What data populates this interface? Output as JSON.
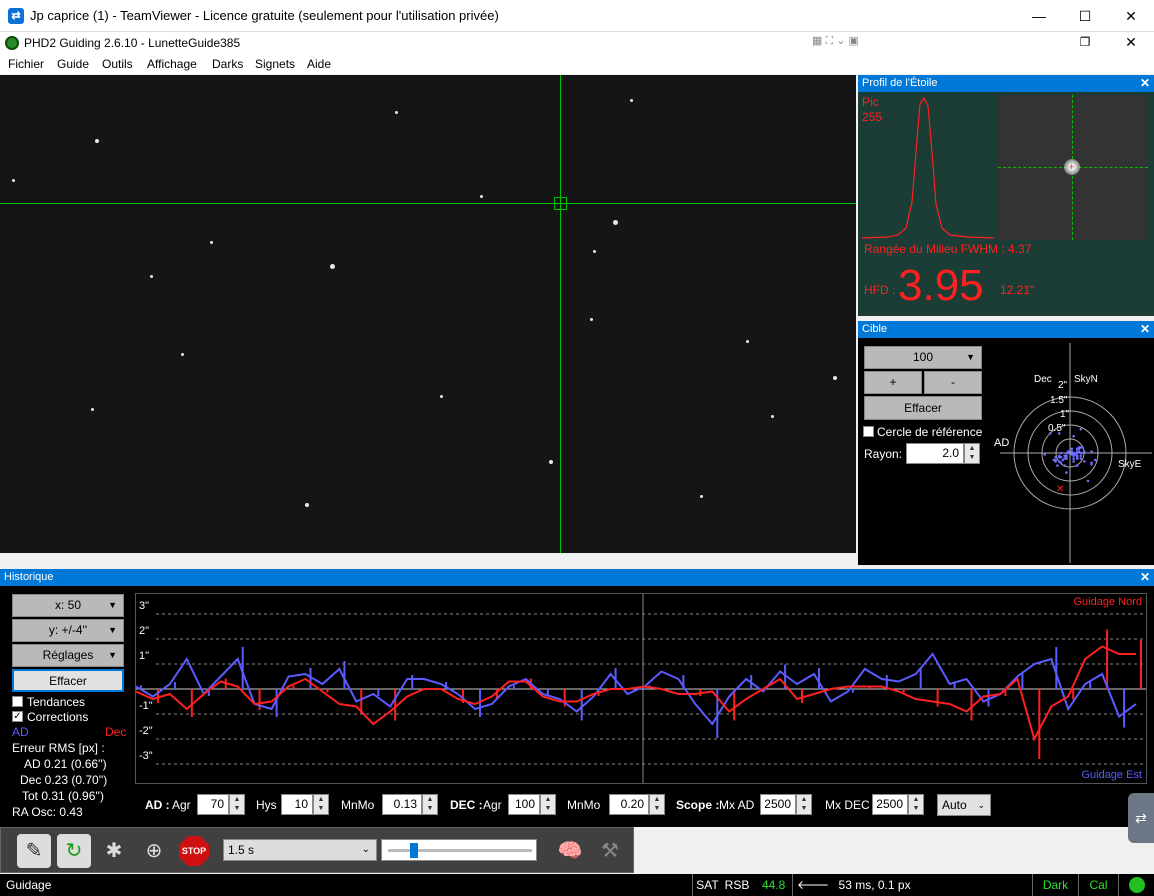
{
  "teamviewer": {
    "title": "Jp caprice (1) - TeamViewer - Licence gratuite (seulement pour l'utilisation privée)",
    "logo_icon": "teamviewer-icon"
  },
  "app": {
    "title": "PHD2 Guiding 2.6.10 - LunetteGuide385"
  },
  "menu": [
    "Fichier",
    "Guide",
    "Outils",
    "Affichage",
    "Darks",
    "Signets",
    "Aide"
  ],
  "star_profile": {
    "title": "Profil de l'Étoile",
    "pic_label": "Pic",
    "pic_value": "255",
    "fwhm_text": "Rangée du Milieu FWHM : 4.37",
    "hfd_label": "HFD :",
    "hfd_value": "3.95",
    "hfd_arcsec": "12.21\""
  },
  "target": {
    "title": "Cible",
    "scale_value": "100",
    "plus": "+",
    "minus": "-",
    "clear": "Effacer",
    "ref_circle": "Cercle de référence",
    "radius_label": "Rayon:",
    "radius_value": "2.0",
    "labels": {
      "dec": "Dec",
      "skyn": "SkyN",
      "ad": "AD",
      "skye": "SkyE",
      "r2": "2\"",
      "r15": "1.5\"",
      "r1": "1\"",
      "r05": "0.5\""
    }
  },
  "history": {
    "title": "Historique",
    "x_select": "x:  50",
    "y_select": "y: +/-4''",
    "settings": "Réglages",
    "clear": "Effacer",
    "trends": "Tendances",
    "corrections": "Corrections",
    "ad_label": "AD",
    "dec_label": "Dec",
    "rms_title": "Erreur RMS [px] :",
    "rms_ad": "AD  0.21 (0.66'')",
    "rms_dec": "Dec  0.23 (0.70'')",
    "rms_tot": "Tot  0.31 (0.96'')",
    "ra_osc": "RA Osc: 0.43",
    "legend_north": "Guidage Nord",
    "legend_east": "Guidage Est",
    "y_ticks": [
      "3\"",
      "2\"",
      "1\"",
      "-1\"",
      "-2\"",
      "-3\""
    ]
  },
  "controls": {
    "ad_label": "AD :",
    "agr_label": "Agr",
    "ad_agr": "70",
    "hys_label": "Hys",
    "hys": "10",
    "mnmo_label": "MnMo",
    "ad_mnmo": "0.13",
    "dec_label": "DEC :",
    "dec_agr": "100",
    "dec_mnmo": "0.20",
    "scope_label": "Scope :",
    "mxad_label": "Mx AD",
    "mxad": "2500",
    "mxdec_label": "Mx DEC",
    "mxdec": "2500",
    "auto": "Auto"
  },
  "toolbar": {
    "exposure": "1.5 s"
  },
  "status": {
    "left": "Guidage",
    "sat": "SAT",
    "rsb": "RSB",
    "rsb_value": "44.8",
    "timing": "53 ms, 0.1 px",
    "dark": "Dark",
    "cal": "Cal"
  },
  "colors": {
    "ra_line": "#5b5bff",
    "dec_line": "#ff2020",
    "crosshair": "#00c000",
    "accent": "#0078d7"
  },
  "chart_data": {
    "type": "line",
    "ylabel": "",
    "ylim": [
      -4,
      4
    ],
    "series": [
      {
        "name": "AD",
        "values": [
          0.1,
          -0.3,
          0.2,
          1.2,
          -0.2,
          0.5,
          1.2,
          -0.6,
          -0.8,
          0.5,
          0.6,
          0.2,
          0.8,
          -0.5,
          -0.2,
          -0.7,
          0.4,
          0.4,
          0.2,
          -0.2,
          -0.8,
          -0.6,
          0.1,
          0.4,
          -0.2,
          -0.4,
          -0.9,
          -0.3,
          0.6,
          -0.2,
          0.1,
          0.7,
          0.4,
          -0.6,
          -1.4,
          -0.3,
          0.4,
          -0.1,
          0.7,
          0.2,
          0.6,
          -0.5,
          -0.1,
          0.8,
          0.4,
          0.3,
          0.6,
          1.4,
          0.2,
          0.4,
          -0.5,
          -0.2,
          0.5,
          1.0,
          1.2,
          -0.8,
          0.2,
          0.6,
          -1.1,
          -0.6
        ]
      },
      {
        "name": "Dec",
        "values": [
          -0.1,
          -0.4,
          -0.2,
          -0.8,
          -0.2,
          0.3,
          0.1,
          -0.6,
          -0.5,
          0.1,
          0.4,
          -0.1,
          -0.6,
          -0.7,
          -1.4,
          -0.9,
          -0.3,
          0.0,
          0.0,
          -0.4,
          -0.6,
          -0.3,
          0.3,
          0.3,
          -0.3,
          -0.5,
          -0.5,
          -0.2,
          0.0,
          0.0,
          0.1,
          0.0,
          -0.2,
          -0.2,
          -0.1,
          -0.9,
          -0.4,
          0.0,
          0.4,
          -0.4,
          -0.2,
          0.0,
          0.1,
          0.1,
          0.1,
          -0.1,
          -0.4,
          -0.5,
          -0.6,
          -0.9,
          -0.3,
          -0.2,
          0.4,
          -2.0,
          -0.7,
          -0.3,
          1.2,
          1.7,
          1.4,
          1.4
        ]
      }
    ]
  }
}
